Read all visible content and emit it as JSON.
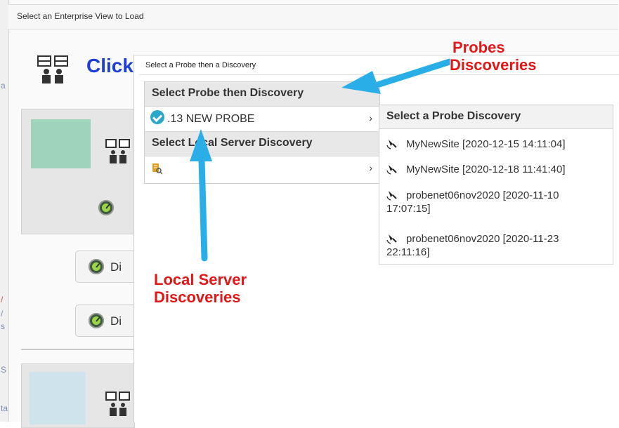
{
  "window": {
    "title": "Select an Enterprise View to Load",
    "left_strip_letters": [
      "a",
      "/",
      "/",
      "s",
      "S",
      "ta"
    ]
  },
  "header": {
    "click_text": "Click"
  },
  "background_buttons": [
    {
      "label": "Di"
    },
    {
      "label": "Di"
    }
  ],
  "dialog": {
    "title": "Select a Probe then a Discovery",
    "menu": {
      "header": "Select Probe then Discovery",
      "probe_item": {
        "label": ".13 NEW PROBE",
        "chevron": "›"
      },
      "local_header": "Select Local Server Discovery",
      "local_item": {
        "label": "",
        "chevron": "›"
      }
    },
    "submenu": {
      "header": "Select a Probe Discovery",
      "items": [
        {
          "line1": "MyNewSite [2020-12-15 14:11:04]",
          "line2": ""
        },
        {
          "line1": "MyNewSite [2020-12-18 11:41:40]",
          "line2": ""
        },
        {
          "line1": "probenet06nov2020 [2020-11-10",
          "line2": "17:07:15]"
        },
        {
          "line1": "probenet06nov2020 [2020-11-23",
          "line2": "22:11:16]"
        }
      ]
    }
  },
  "annotations": {
    "probes_line1": "Probes",
    "probes_line2": "Discoveries",
    "local_line1": "Local Server",
    "local_line2": "Discoveries"
  },
  "colors": {
    "annotation_red": "#e01818",
    "arrow_blue": "#2aaee8",
    "click_blue": "#1e3fd6",
    "probe_icon": "#2aa7c9"
  },
  "icons": [
    "enterprise-view-icon",
    "radar-icon",
    "probe-check-icon",
    "local-search-icon",
    "satellite-icon",
    "chevron-right-icon",
    "arrow-icon"
  ]
}
